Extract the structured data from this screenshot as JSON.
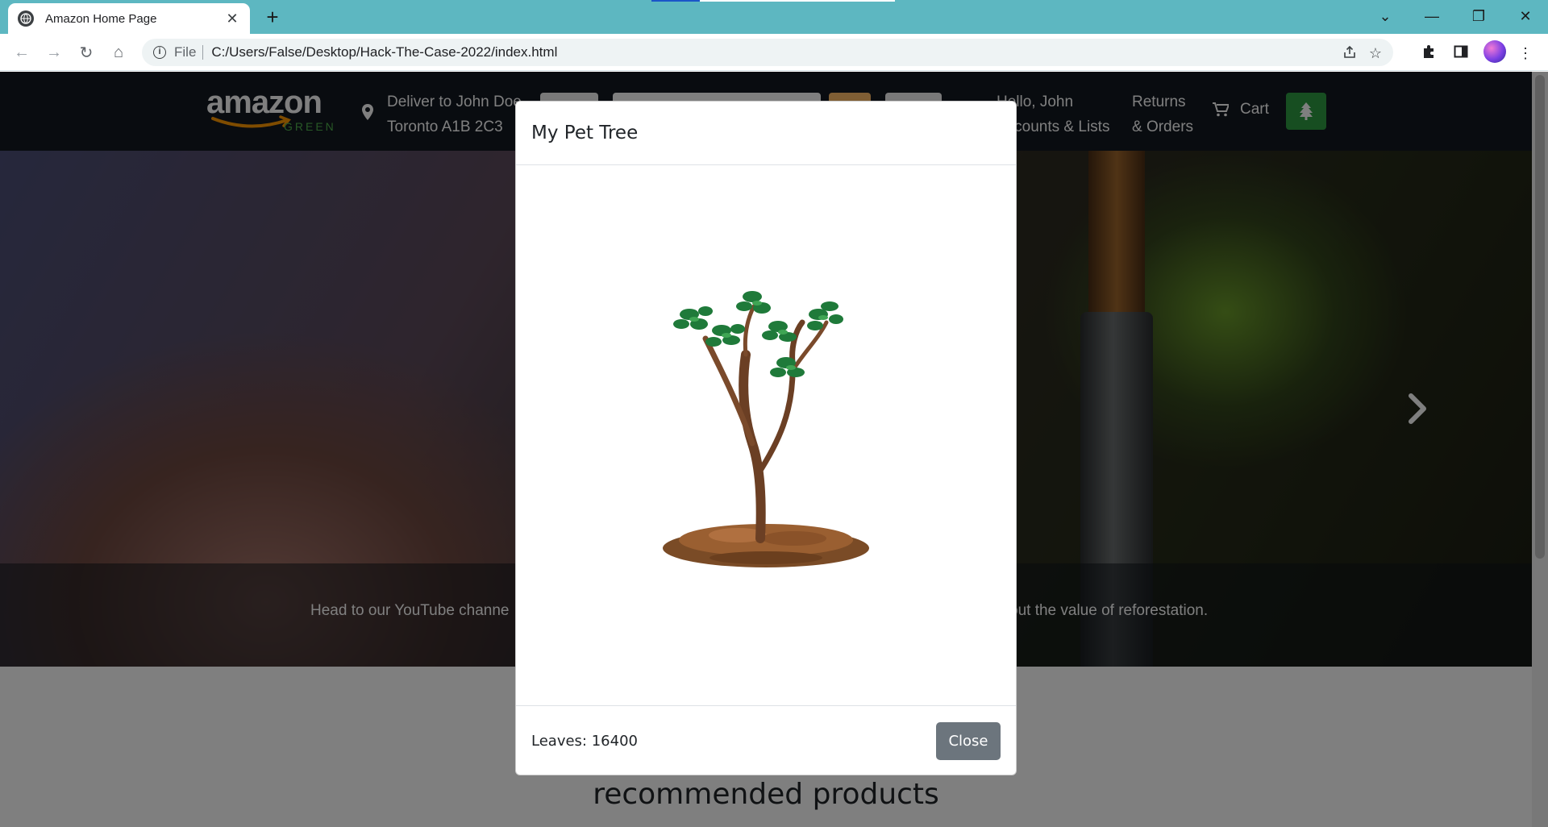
{
  "browser": {
    "tab_title": "Amazon Home Page",
    "tab_close": "✕",
    "new_tab": "+",
    "scheme": "File",
    "url": "C:/Users/False/Desktop/Hack-The-Case-2022/index.html",
    "controls": {
      "tab_search": "⌄",
      "minimize": "—",
      "restore": "❐",
      "close": "✕"
    },
    "nav": {
      "back": "←",
      "forward": "→",
      "reload": "↻",
      "home": "⌂"
    },
    "toolbar_icons": [
      "share-icon",
      "star-icon",
      "extensions-icon",
      "side-panel-icon",
      "profile-avatar",
      "more-menu-icon"
    ]
  },
  "navbar": {
    "logo_text": "amazon",
    "logo_sub": "GREEN",
    "deliver_line1": "Deliver to John Doe",
    "deliver_line2": "Toronto A1B 2C3",
    "hello_line1": "Hello, John",
    "hello_line2": "Accounts & Lists",
    "returns_line1": "Returns",
    "returns_line2": "& Orders",
    "cart_label": "Cart",
    "colors": {
      "bar": "#131921",
      "accent": "#febd69",
      "tree_button": "#2e9c43"
    }
  },
  "hero": {
    "caption_left": "Head to our YouTube channe",
    "caption_right": "out the value of reforestation."
  },
  "section": {
    "recommended_title": "recommended products"
  },
  "modal": {
    "title": "My Pet Tree",
    "leaves_text": "Leaves: 16400",
    "close_label": "Close",
    "close_color": "#6c757d"
  }
}
